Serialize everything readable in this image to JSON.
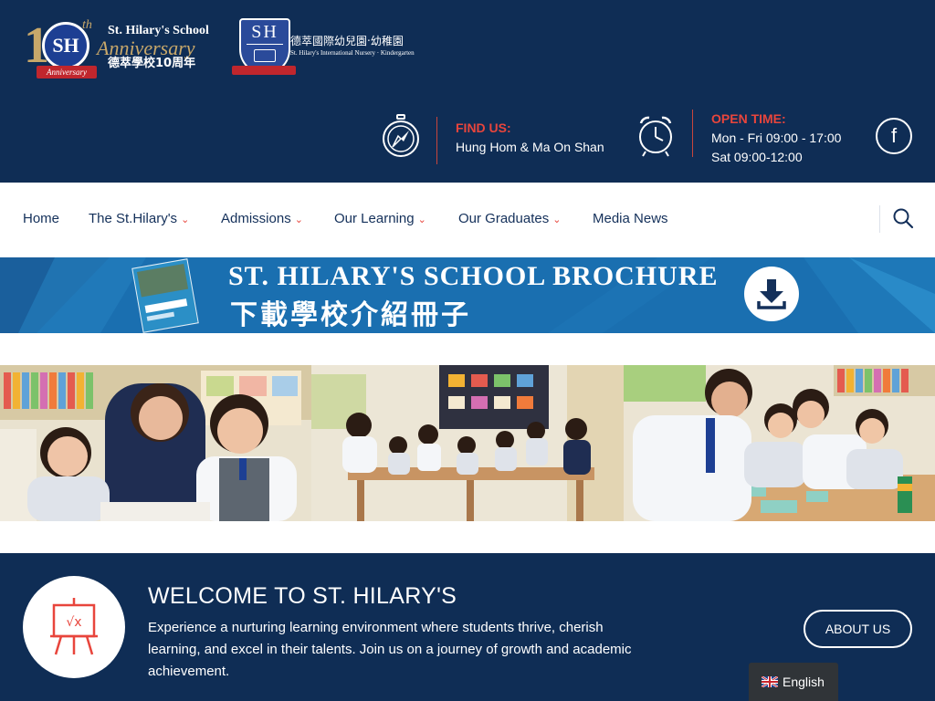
{
  "logos": {
    "anniversary": {
      "school_name": "St. Hilary's School",
      "number": "10",
      "suffix": "th",
      "badge": "SH",
      "word": "Anniversary",
      "ribbon": "Anniversary",
      "chinese": "德萃學校10周年"
    },
    "nursery": {
      "badge": "SH",
      "chinese": "德萃國際幼兒園‧幼稚園",
      "english": "St. Hilary's International Nursery · Kindergarten"
    }
  },
  "contact": {
    "find_us_label": "FIND US:",
    "find_us_value": "Hung Hom & Ma On Shan",
    "open_time_label": "OPEN TIME:",
    "open_time_weekday": "Mon - Fri 09:00 - 17:00",
    "open_time_saturday": "Sat 09:00-12:00",
    "facebook_glyph": "f"
  },
  "nav": {
    "items": [
      {
        "label": "Home",
        "has_dropdown": false
      },
      {
        "label": "The St.Hilary's",
        "has_dropdown": true
      },
      {
        "label": "Admissions",
        "has_dropdown": true
      },
      {
        "label": "Our Learning",
        "has_dropdown": true
      },
      {
        "label": "Our Graduates",
        "has_dropdown": true
      },
      {
        "label": "Media News",
        "has_dropdown": false
      }
    ],
    "chevron": "⌄"
  },
  "banner": {
    "title_en": "ST. HILARY'S  SCHOOL BROCHURE",
    "title_zh": "下載學校介紹冊子"
  },
  "welcome": {
    "title": "WELCOME TO ST. HILARY'S",
    "text": "Experience a nurturing learning environment where students thrive, cherish learning, and excel in their talents. Join us on a journey of growth and academic achievement.",
    "button": "ABOUT US"
  },
  "language": {
    "label": "English"
  },
  "icons": {
    "compass": "compass-icon",
    "clock": "alarm-clock-icon",
    "facebook": "facebook-icon",
    "search": "search-icon",
    "download": "download-icon",
    "easel": "easel-icon",
    "flag": "uk-flag-icon"
  },
  "colors": {
    "header_navy": "#0f2d55",
    "accent_red": "#e8453c",
    "banner_blue": "#1a6fb0",
    "nav_text": "#14305a"
  }
}
